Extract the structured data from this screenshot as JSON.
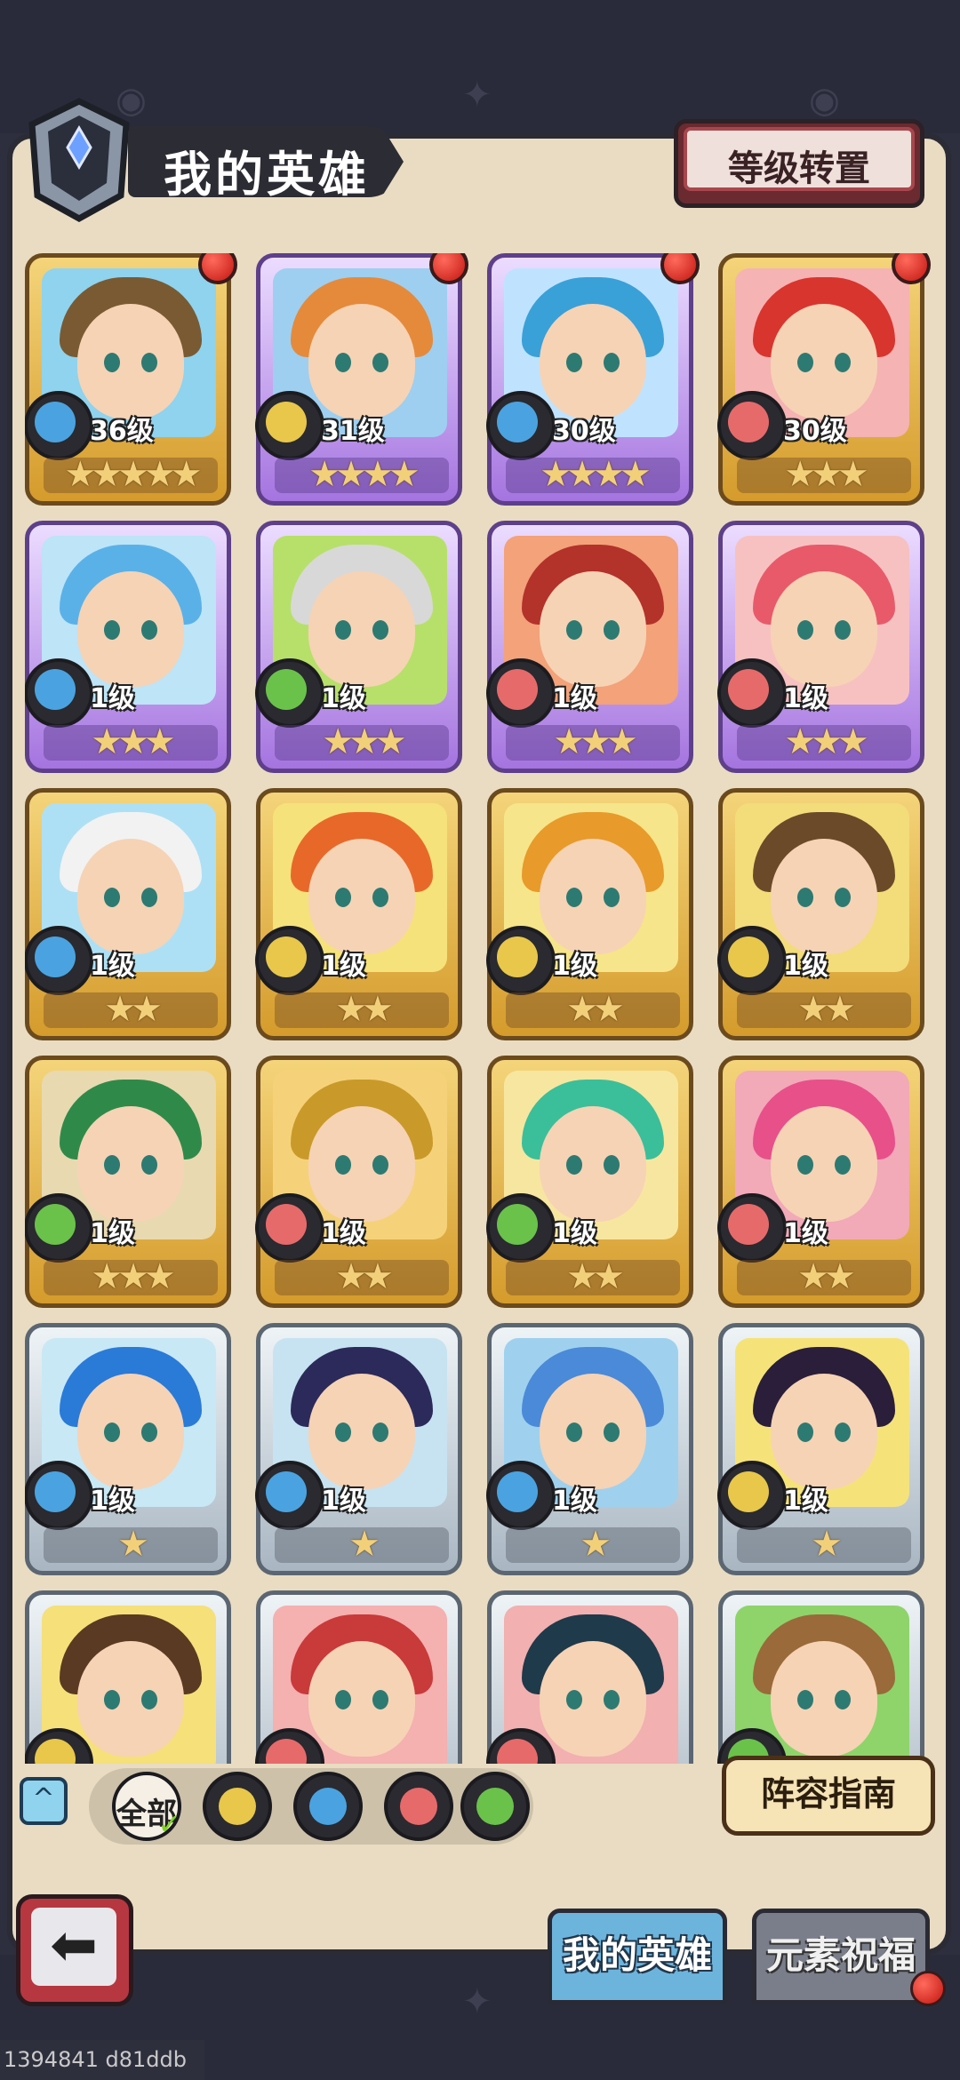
{
  "header": {
    "title": "我的英雄",
    "level_transfer_button": "等级转置"
  },
  "colors": {
    "water": "#4aa3e0",
    "earth": "#e8c74a",
    "fire": "#e76a6a",
    "wood": "#6ac24a"
  },
  "heroes": [
    {
      "level": "36级",
      "stars": "★★★★★",
      "element": "water",
      "rarity": "gold",
      "red_dot": true,
      "hair": "#7a5a32",
      "bg": "#8fd3ee"
    },
    {
      "level": "31级",
      "stars": "★★★★",
      "element": "earth",
      "rarity": "purple",
      "red_dot": true,
      "hair": "#e58a3a",
      "bg": "#9ecff0"
    },
    {
      "level": "30级",
      "stars": "★★★★",
      "element": "water",
      "rarity": "purple",
      "red_dot": true,
      "hair": "#3aa0d8",
      "bg": "#bfe3ff"
    },
    {
      "level": "30级",
      "stars": "★★★",
      "element": "fire",
      "rarity": "gold",
      "red_dot": true,
      "hair": "#d8352e",
      "bg": "#f5b3b3"
    },
    {
      "level": "1级",
      "stars": "★★★",
      "element": "water",
      "rarity": "purple",
      "red_dot": false,
      "hair": "#5ab1e8",
      "bg": "#bde4f7"
    },
    {
      "level": "1级",
      "stars": "★★★",
      "element": "wood",
      "rarity": "purple",
      "red_dot": false,
      "hair": "#d8d8d8",
      "bg": "#b7e06a"
    },
    {
      "level": "1级",
      "stars": "★★★",
      "element": "fire",
      "rarity": "purple",
      "red_dot": false,
      "hair": "#b3322a",
      "bg": "#f3a27a"
    },
    {
      "level": "1级",
      "stars": "★★★",
      "element": "fire",
      "rarity": "purple",
      "red_dot": false,
      "hair": "#e85a6a",
      "bg": "#f7c1c1"
    },
    {
      "level": "1级",
      "stars": "★★",
      "element": "water",
      "rarity": "gold",
      "red_dot": false,
      "hair": "#f2f2f2",
      "bg": "#aee0f5"
    },
    {
      "level": "1级",
      "stars": "★★",
      "element": "earth",
      "rarity": "gold",
      "red_dot": false,
      "hair": "#e8682a",
      "bg": "#f5e27a"
    },
    {
      "level": "1级",
      "stars": "★★",
      "element": "earth",
      "rarity": "gold",
      "red_dot": false,
      "hair": "#e89a2a",
      "bg": "#f6e58a"
    },
    {
      "level": "1级",
      "stars": "★★",
      "element": "earth",
      "rarity": "gold",
      "red_dot": false,
      "hair": "#6b4a2a",
      "bg": "#f3dc7a"
    },
    {
      "level": "1级",
      "stars": "★★★",
      "element": "wood",
      "rarity": "gold",
      "red_dot": false,
      "hair": "#2f8a4a",
      "bg": "#e8d9b0"
    },
    {
      "level": "1级",
      "stars": "★★",
      "element": "fire",
      "rarity": "gold",
      "red_dot": false,
      "hair": "#c99a2a",
      "bg": "#f5d27a"
    },
    {
      "level": "1级",
      "stars": "★★",
      "element": "wood",
      "rarity": "gold",
      "red_dot": false,
      "hair": "#3abf9a",
      "bg": "#f7e6a0"
    },
    {
      "level": "1级",
      "stars": "★★",
      "element": "fire",
      "rarity": "gold",
      "red_dot": false,
      "hair": "#e8508a",
      "bg": "#f2a9b8"
    },
    {
      "level": "1级",
      "stars": "★",
      "element": "water",
      "rarity": "silver",
      "red_dot": false,
      "hair": "#2a7ad8",
      "bg": "#c8e8f5"
    },
    {
      "level": "1级",
      "stars": "★",
      "element": "water",
      "rarity": "silver",
      "red_dot": false,
      "hair": "#2b2a5a",
      "bg": "#c7e3f2"
    },
    {
      "level": "1级",
      "stars": "★",
      "element": "water",
      "rarity": "silver",
      "red_dot": false,
      "hair": "#4a8ad8",
      "bg": "#9fd1ef"
    },
    {
      "level": "1级",
      "stars": "★",
      "element": "earth",
      "rarity": "silver",
      "red_dot": false,
      "hair": "#2a1e3a",
      "bg": "#f5e37a"
    },
    {
      "level": "",
      "stars": "",
      "element": "earth",
      "rarity": "silver",
      "red_dot": false,
      "hair": "#5a3a22",
      "bg": "#f5e07a"
    },
    {
      "level": "",
      "stars": "",
      "element": "fire",
      "rarity": "silver",
      "red_dot": false,
      "hair": "#c93a3a",
      "bg": "#f5b0b0"
    },
    {
      "level": "",
      "stars": "",
      "element": "fire",
      "rarity": "silver",
      "red_dot": false,
      "hair": "#1f3a4a",
      "bg": "#f2b0b0"
    },
    {
      "level": "",
      "stars": "",
      "element": "wood",
      "rarity": "silver",
      "red_dot": false,
      "hair": "#9a6a3a",
      "bg": "#8ed46a"
    }
  ],
  "filters": {
    "all_label": "全部",
    "toggle_icon": "^"
  },
  "guide_button": "阵容指南",
  "tabs": {
    "my_heroes": "我的英雄",
    "element_blessing": "元素祝福"
  },
  "watermark": "1394841 d81ddb"
}
